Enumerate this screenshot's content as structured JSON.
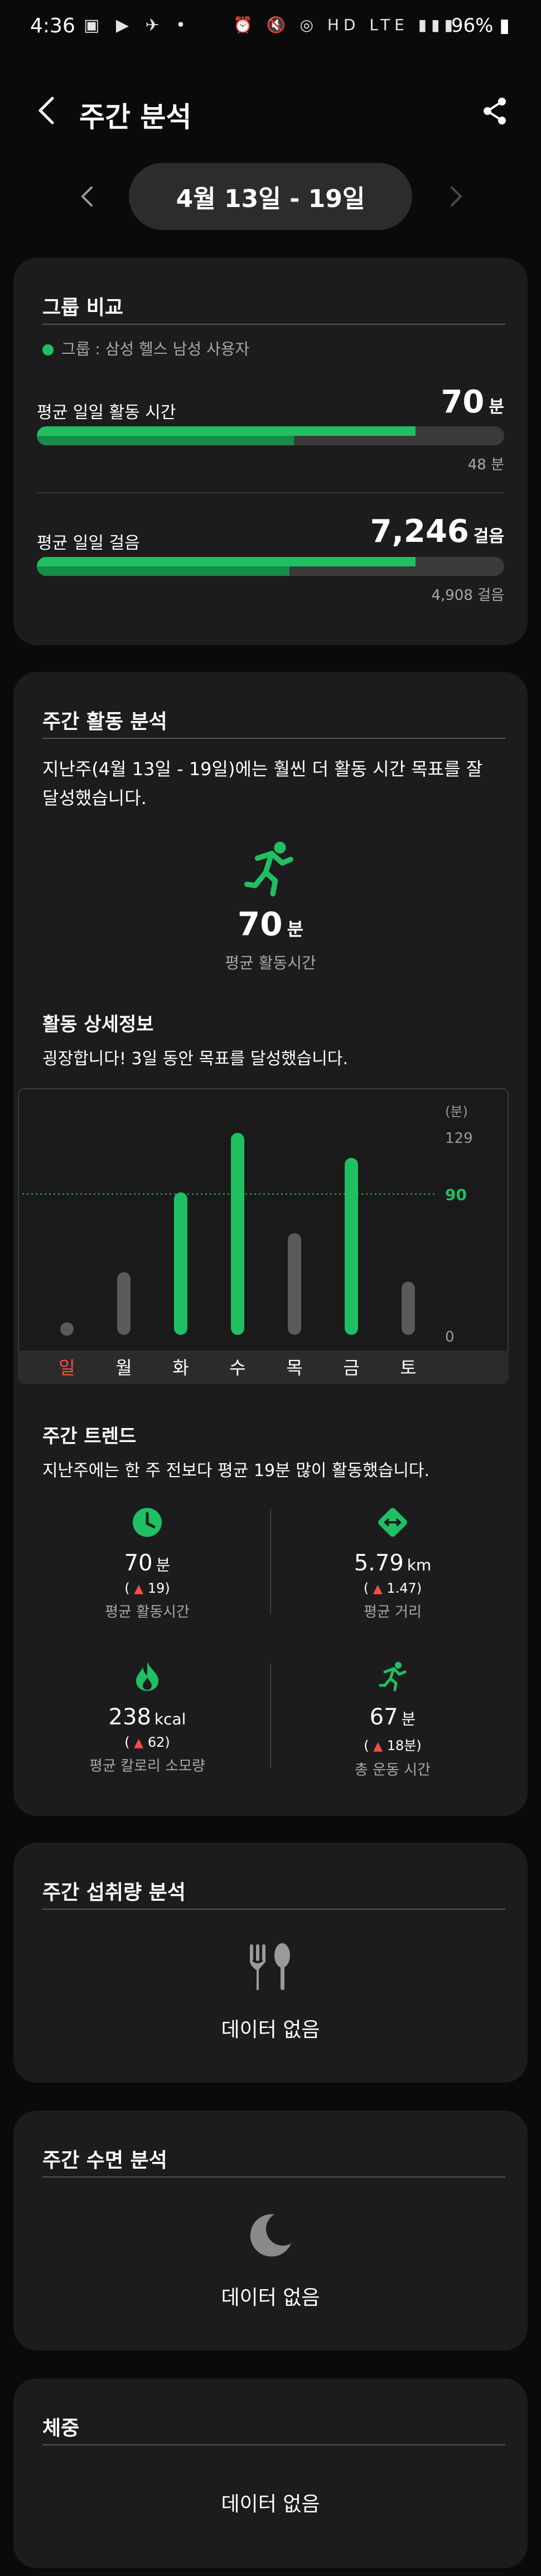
{
  "status_bar": {
    "time": "4:36",
    "left_icons": "▣ ▶ ✈ •",
    "right_icons": "⏰ 🔇 ◎ HD LTE ▮▮▮",
    "battery": "96%"
  },
  "header": {
    "title": "주간 분석"
  },
  "date_range": "4월 13일 - 19일",
  "group_compare": {
    "title": "그룹 비교",
    "group_label": "그룹 : 삼성 헬스 남성 사용자",
    "activity_time": {
      "label": "평균 일일 활동 시간",
      "value": "70",
      "unit": "분",
      "group_value": "48 분",
      "my_ratio": 0.81,
      "group_ratio": 0.55
    },
    "steps": {
      "label": "평균 일일 걸음",
      "value": "7,246",
      "unit": "걸음",
      "group_value": "4,908 걸음",
      "my_ratio": 0.81,
      "group_ratio": 0.54
    }
  },
  "weekly_activity": {
    "title": "주간 활동 분석",
    "summary": "지난주(4월 13일 - 19일)에는 훨씬 더 활동 시간 목표를 잘 달성했습니다.",
    "summary_line1": "지난주(4월 13일 - 19일)에는 훨씬 더 활동 시간 목표를 잘",
    "summary_line2": "달성했습니다.",
    "avg_value": "70",
    "avg_unit": "분",
    "avg_label": "평균 활동시간",
    "detail_title": "활동 상세정보",
    "detail_text": "굉장합니다! 3일 동안 목표를 달성했습니다."
  },
  "chart_data": {
    "type": "bar",
    "categories": [
      "일",
      "월",
      "화",
      "수",
      "목",
      "금",
      "토"
    ],
    "values": [
      8,
      40,
      91,
      129,
      65,
      113,
      34
    ],
    "goal_met": [
      false,
      false,
      true,
      true,
      false,
      true,
      false
    ],
    "ylabel": "(분)",
    "ylim": [
      0,
      129
    ],
    "y_ticks": [
      "129",
      "90",
      "0"
    ],
    "goal_line": 90,
    "goal_label": "90",
    "colors": {
      "met": "#20c062",
      "unmet": "#5a5a5a",
      "sunday": "#ff4a4a",
      "goal": "#20c062"
    }
  },
  "weekly_trend": {
    "title": "주간 트렌드",
    "summary": "지난주에는 한 주 전보다 평균 19분 많이 활동했습니다.",
    "items": [
      {
        "icon": "clock-icon",
        "value": "70",
        "unit": "분",
        "delta": "19",
        "label": "평균 활동시간"
      },
      {
        "icon": "distance-icon",
        "value": "5.79",
        "unit": "km",
        "delta": "1.47",
        "label": "평균 거리"
      },
      {
        "icon": "flame-icon",
        "value": "238",
        "unit": "kcal",
        "delta": "62",
        "label": "평균 칼로리 소모량"
      },
      {
        "icon": "runner-icon",
        "value": "67",
        "unit": "분",
        "delta": "18분",
        "label": "총 운동 시간"
      }
    ]
  },
  "intake": {
    "title": "주간 섭취량 분석",
    "empty": "데이터 없음"
  },
  "sleep": {
    "title": "주간 수면 분석",
    "empty": "데이터 없음"
  },
  "weight": {
    "title": "체중",
    "empty": "데이터 없음"
  },
  "colors": {
    "accent": "#20c062",
    "card": "#1c1c1e",
    "background": "#0a0a0a"
  }
}
